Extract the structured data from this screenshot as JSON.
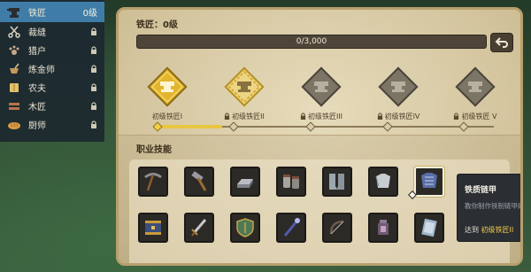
{
  "sidebar": {
    "items": [
      {
        "label": "铁匠",
        "level": "0级",
        "icon": "anvil-icon",
        "active": true
      },
      {
        "label": "裁缝",
        "icon": "scissors-icon",
        "locked": true
      },
      {
        "label": "猎户",
        "icon": "paw-icon",
        "locked": true
      },
      {
        "label": "炼金师",
        "icon": "mortar-icon",
        "locked": true
      },
      {
        "label": "农夫",
        "icon": "wheat-icon",
        "locked": true
      },
      {
        "label": "木匠",
        "icon": "saw-icon",
        "locked": true
      },
      {
        "label": "厨师",
        "icon": "bread-icon",
        "locked": true
      }
    ]
  },
  "panel": {
    "title": "铁匠：0级",
    "xp_text": "0/3,000",
    "xp_progress": 0
  },
  "ranks": [
    {
      "label": "初级铁匠I",
      "state": "unlocked",
      "locked": false
    },
    {
      "label": "初级铁匠II",
      "state": "current",
      "locked": true
    },
    {
      "label": "初级铁匠III",
      "state": "locked",
      "locked": true
    },
    {
      "label": "初级铁匠IV",
      "state": "locked",
      "locked": true
    },
    {
      "label": "初级铁匠 V",
      "state": "locked",
      "locked": true
    }
  ],
  "track_progress": 0.2,
  "section": {
    "title": "职业技能"
  },
  "skills": [
    {
      "name": "pickaxe-icon"
    },
    {
      "name": "hammer-icon"
    },
    {
      "name": "iron-ingot-icon"
    },
    {
      "name": "gauntlets-icon"
    },
    {
      "name": "greaves-icon"
    },
    {
      "name": "cloth-armor-icon"
    },
    {
      "name": "chainmail-icon",
      "selected": true
    },
    {
      "name": "chest-icon"
    },
    {
      "name": "sword-icon"
    },
    {
      "name": "shield-icon"
    },
    {
      "name": "staff-icon"
    },
    {
      "name": "bow-icon"
    },
    {
      "name": "lantern-icon"
    },
    {
      "name": "scroll-icon"
    }
  ],
  "tooltip": {
    "title": "铁质链甲",
    "desc": "教你制作铁制链甲的才",
    "req_prefix": "达到",
    "req_target": "初级铁匠II"
  },
  "colors": {
    "sidebar_active": "#3f7da8",
    "gold": "#e9c640",
    "panel_bg": "#d7c9a4"
  }
}
